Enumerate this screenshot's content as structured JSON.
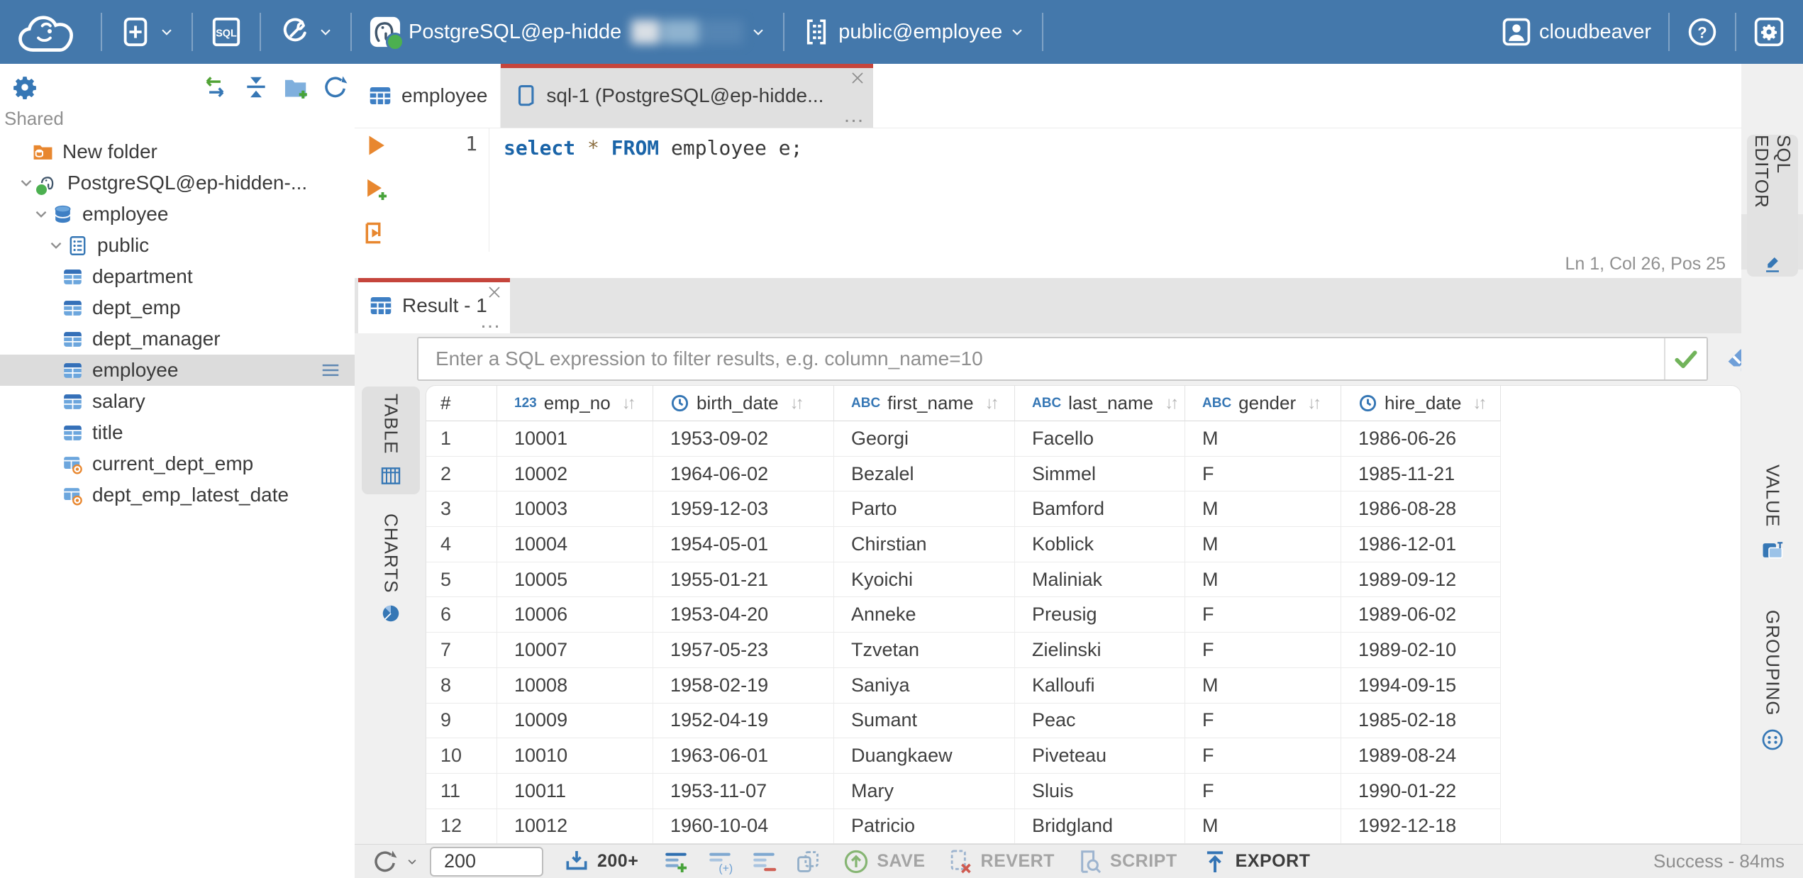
{
  "colors": {
    "topbar_blue": "#4478ab",
    "accent_red": "#c5453c",
    "icon_blue": "#3677b5",
    "icon_orange": "#e8872f",
    "icon_green": "#4cb050",
    "selected_gray": "#dcdcdc"
  },
  "topbar": {
    "connection": {
      "label": "PostgreSQL@ep-hidde"
    },
    "schema": {
      "label": "public@employee"
    },
    "user": {
      "label": "cloudbeaver"
    }
  },
  "sidebar": {
    "section": "Shared",
    "tree": [
      {
        "label": "New folder",
        "icon": "folderdb",
        "level": 1,
        "chevron": false
      },
      {
        "label": "PostgreSQL@ep-hidden-...",
        "icon": "pg",
        "level": 0,
        "chevron": true,
        "status": true
      },
      {
        "label": "employee",
        "icon": "db",
        "level": 1,
        "chevron": true
      },
      {
        "label": "public",
        "icon": "schema",
        "level": 2,
        "chevron": true
      },
      {
        "label": "department",
        "icon": "table",
        "level": 3
      },
      {
        "label": "dept_emp",
        "icon": "table",
        "level": 3
      },
      {
        "label": "dept_manager",
        "icon": "table",
        "level": 3
      },
      {
        "label": "employee",
        "icon": "table",
        "level": 3,
        "selected": true
      },
      {
        "label": "salary",
        "icon": "table",
        "level": 3
      },
      {
        "label": "title",
        "icon": "table",
        "level": 3
      },
      {
        "label": "current_dept_emp",
        "icon": "view",
        "level": 3
      },
      {
        "label": "dept_emp_latest_date",
        "icon": "view",
        "level": 3
      }
    ]
  },
  "editor": {
    "tabs": [
      {
        "label": "employee"
      },
      {
        "label": "sql-1 (PostgreSQL@ep-hidde..."
      }
    ],
    "line_number": "1",
    "sql": [
      [
        "select",
        "kw"
      ],
      [
        " ",
        "p"
      ],
      [
        "*",
        "star"
      ],
      [
        " ",
        "p"
      ],
      [
        "FROM",
        "kw"
      ],
      [
        " employee e;",
        "p"
      ]
    ],
    "status": "Ln 1, Col 26, Pos 25"
  },
  "results": {
    "tab": {
      "label": "Result - 1"
    },
    "filter_placeholder": "Enter a SQL expression to filter results, e.g. column_name=10",
    "rail": {
      "table": "TABLE",
      "charts": "CHARTS"
    },
    "right_tabs": {
      "editor": "SQL EDITOR",
      "value": "VALUE",
      "grouping": "GROUPING"
    },
    "table": {
      "columns": [
        {
          "name": "#",
          "type": null
        },
        {
          "name": "emp_no",
          "type": "123"
        },
        {
          "name": "birth_date",
          "type": "clock"
        },
        {
          "name": "first_name",
          "type": "abc"
        },
        {
          "name": "last_name",
          "type": "abc"
        },
        {
          "name": "gender",
          "type": "abc"
        },
        {
          "name": "hire_date",
          "type": "clock"
        }
      ],
      "rows": [
        [
          "1",
          "10001",
          "1953-09-02",
          "Georgi",
          "Facello",
          "M",
          "1986-06-26"
        ],
        [
          "2",
          "10002",
          "1964-06-02",
          "Bezalel",
          "Simmel",
          "F",
          "1985-11-21"
        ],
        [
          "3",
          "10003",
          "1959-12-03",
          "Parto",
          "Bamford",
          "M",
          "1986-08-28"
        ],
        [
          "4",
          "10004",
          "1954-05-01",
          "Chirstian",
          "Koblick",
          "M",
          "1986-12-01"
        ],
        [
          "5",
          "10005",
          "1955-01-21",
          "Kyoichi",
          "Maliniak",
          "M",
          "1989-09-12"
        ],
        [
          "6",
          "10006",
          "1953-04-20",
          "Anneke",
          "Preusig",
          "F",
          "1989-06-02"
        ],
        [
          "7",
          "10007",
          "1957-05-23",
          "Tzvetan",
          "Zielinski",
          "F",
          "1989-02-10"
        ],
        [
          "8",
          "10008",
          "1958-02-19",
          "Saniya",
          "Kalloufi",
          "M",
          "1994-09-15"
        ],
        [
          "9",
          "10009",
          "1952-04-19",
          "Sumant",
          "Peac",
          "F",
          "1985-02-18"
        ],
        [
          "10",
          "10010",
          "1963-06-01",
          "Duangkaew",
          "Piveteau",
          "F",
          "1989-08-24"
        ],
        [
          "11",
          "10011",
          "1953-11-07",
          "Mary",
          "Sluis",
          "F",
          "1990-01-22"
        ],
        [
          "12",
          "10012",
          "1960-10-04",
          "Patricio",
          "Bridgland",
          "M",
          "1992-12-18"
        ]
      ]
    },
    "toolbar": {
      "fetch_size": "200",
      "fetch_more": "200+",
      "save": "SAVE",
      "revert": "REVERT",
      "script": "SCRIPT",
      "export": "EXPORT",
      "status": "Success - 84ms"
    }
  }
}
